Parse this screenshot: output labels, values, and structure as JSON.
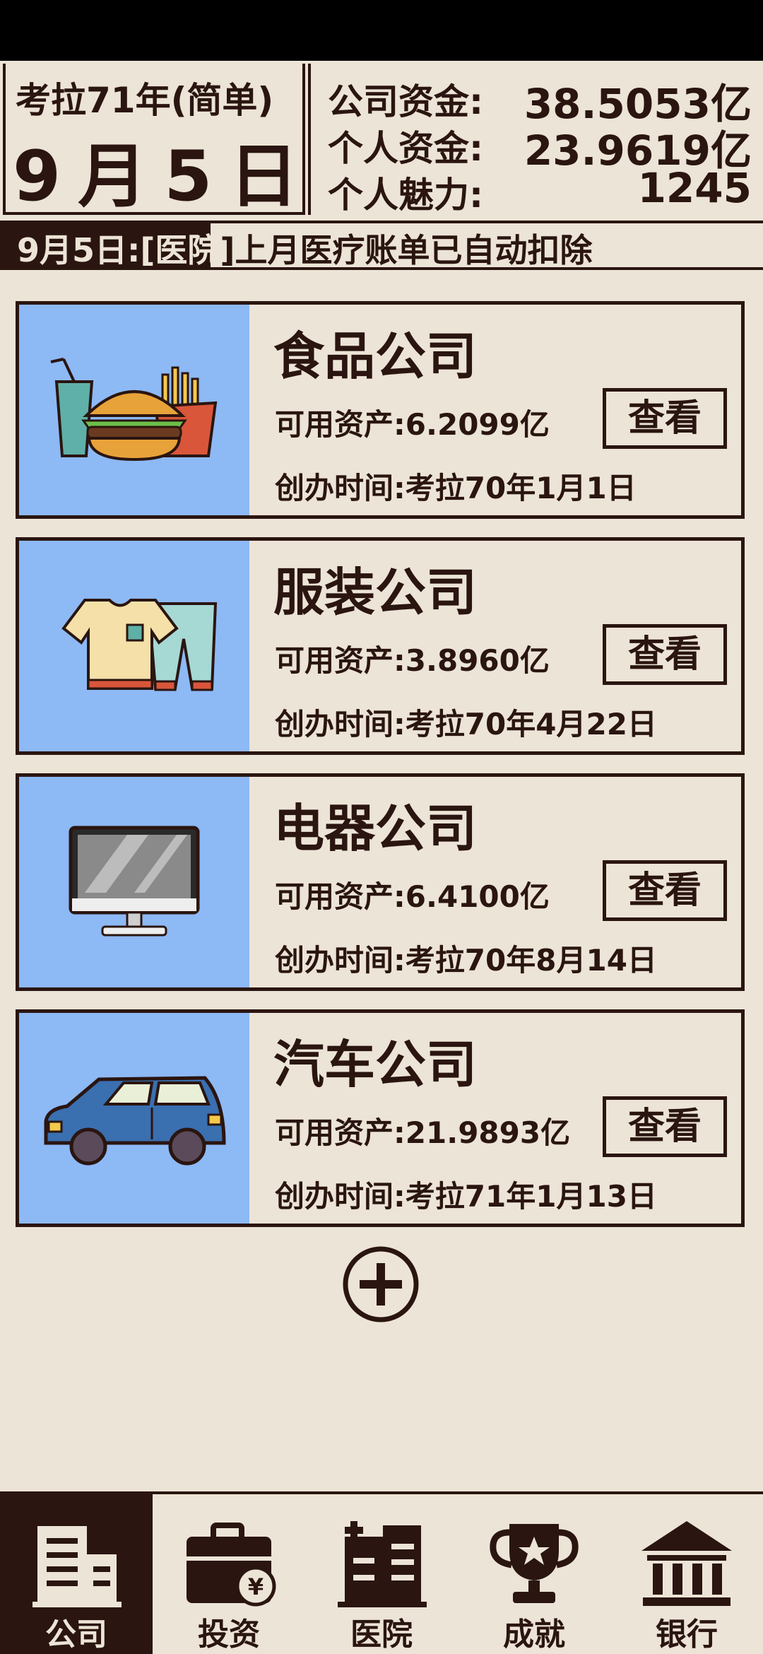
{
  "header": {
    "year_label": "考拉71年(简单)",
    "month": "9",
    "month_unit": "月",
    "day": "5",
    "day_unit": "日",
    "stats": [
      {
        "label": "公司资金:",
        "value": "38.5053亿"
      },
      {
        "label": "个人资金:",
        "value": "23.9619亿"
      },
      {
        "label": "个人魅力:",
        "value": "1245"
      }
    ]
  },
  "news": {
    "part_a": "9月5日:[医院",
    "part_b": "]上月医疗账单已自动扣除"
  },
  "companies": [
    {
      "name": "食品公司",
      "assets": "可用资产:6.2099亿",
      "founded": "创办时间:考拉70年1月1日",
      "view_label": "查看",
      "icon": "food-icon"
    },
    {
      "name": "服装公司",
      "assets": "可用资产:3.8960亿",
      "founded": "创办时间:考拉70年4月22日",
      "view_label": "查看",
      "icon": "clothing-icon"
    },
    {
      "name": "电器公司",
      "assets": "可用资产:6.4100亿",
      "founded": "创办时间:考拉70年8月14日",
      "view_label": "查看",
      "icon": "computer-icon"
    },
    {
      "name": "汽车公司",
      "assets": "可用资产:21.9893亿",
      "founded": "创办时间:考拉71年1月13日",
      "view_label": "查看",
      "icon": "car-icon"
    }
  ],
  "add_button": {
    "icon": "plus-circle-icon"
  },
  "nav": [
    {
      "label": "公司",
      "icon": "company-building-icon",
      "active": true
    },
    {
      "label": "投资",
      "icon": "briefcase-yen-icon",
      "active": false
    },
    {
      "label": "医院",
      "icon": "hospital-icon",
      "active": false
    },
    {
      "label": "成就",
      "icon": "trophy-icon",
      "active": false
    },
    {
      "label": "银行",
      "icon": "bank-icon",
      "active": false
    }
  ],
  "colors": {
    "background": "#ece4d6",
    "ink": "#2a1510",
    "card_image_bg": "#8db9f5"
  }
}
